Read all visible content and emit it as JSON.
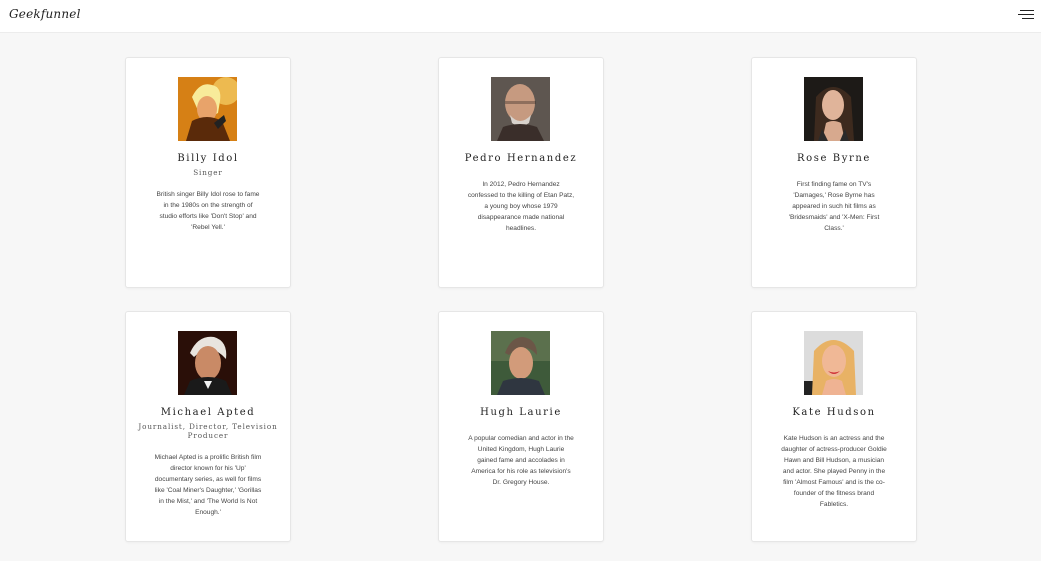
{
  "header": {
    "brand": "Geekfunnel",
    "menu_icon": "hamburger-menu-icon"
  },
  "cards": [
    {
      "name": "Billy Idol",
      "role": "Singer",
      "bio": "British singer Billy Idol rose to fame in the 1980s on the strength of studio efforts like 'Don't Stop' and 'Rebel Yell.'",
      "photo": "portrait-photo"
    },
    {
      "name": "Pedro Hernandez",
      "role": "",
      "bio": "In 2012, Pedro Hernandez confessed to the killing of Etan Patz, a young boy whose 1979 disappearance made national headlines.",
      "photo": "portrait-photo"
    },
    {
      "name": "Rose Byrne",
      "role": "",
      "bio": "First finding fame on TV's 'Damages,' Rose Byrne has appeared in such hit films as 'Bridesmaids' and 'X-Men: First Class.'",
      "photo": "portrait-photo"
    },
    {
      "name": "Michael Apted",
      "role": "Journalist, Director, Television Producer",
      "bio": "Michael Apted is a prolific British film director known for his 'Up' documentary series, as well for films like 'Coal Miner's Daughter,' 'Gorillas in the Mist,' and 'The World Is Not Enough.'",
      "photo": "portrait-photo"
    },
    {
      "name": "Hugh Laurie",
      "role": "",
      "bio": "A popular comedian and actor in the United Kingdom, Hugh Laurie gained fame and accolades in America for his role as television's Dr. Gregory House.",
      "photo": "portrait-photo"
    },
    {
      "name": "Kate Hudson",
      "role": "",
      "bio": "Kate Hudson is an actress and the daughter of actress-producer Goldie Hawn and Bill Hudson, a musician and actor. She played Penny in the film 'Almost Famous' and is the co-founder of the fitness brand Fabletics.",
      "photo": "portrait-photo"
    }
  ]
}
